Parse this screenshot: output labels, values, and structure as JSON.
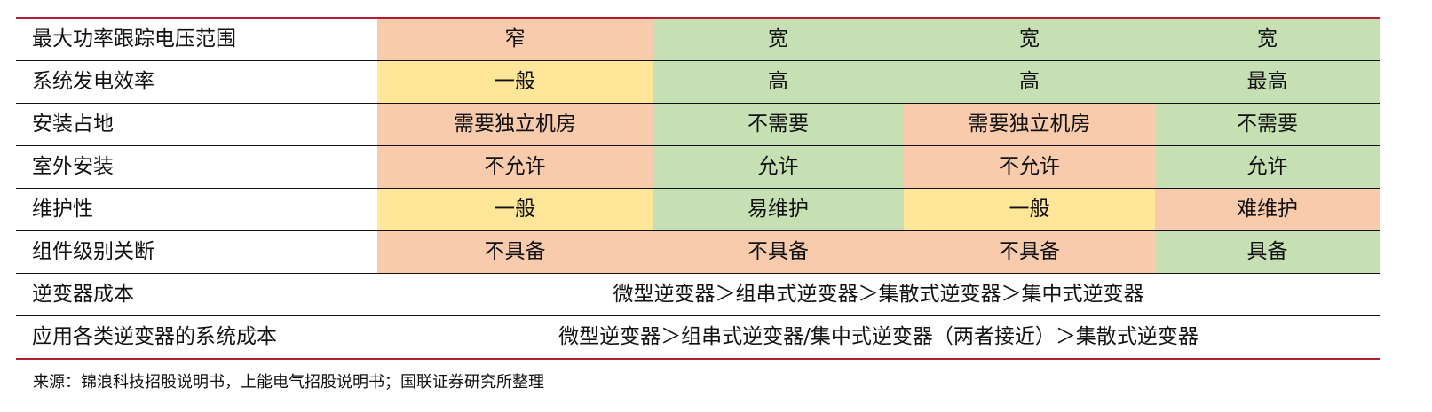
{
  "colors": {
    "border_accent": "#b01e2f",
    "narrow_bad": "#f8cbad",
    "medium": "#ffe699",
    "good": "#c6e0b4"
  },
  "rows": [
    {
      "label": "最大功率跟踪电压范围",
      "cells": [
        {
          "text": "窄",
          "tone": "orange"
        },
        {
          "text": "宽",
          "tone": "green"
        },
        {
          "text": "宽",
          "tone": "green"
        },
        {
          "text": "宽",
          "tone": "green"
        }
      ]
    },
    {
      "label": "系统发电效率",
      "cells": [
        {
          "text": "一般",
          "tone": "yellow"
        },
        {
          "text": "高",
          "tone": "green"
        },
        {
          "text": "高",
          "tone": "green"
        },
        {
          "text": "最高",
          "tone": "green"
        }
      ]
    },
    {
      "label": "安装占地",
      "cells": [
        {
          "text": "需要独立机房",
          "tone": "orange"
        },
        {
          "text": "不需要",
          "tone": "green"
        },
        {
          "text": "需要独立机房",
          "tone": "orange"
        },
        {
          "text": "不需要",
          "tone": "green"
        }
      ]
    },
    {
      "label": "室外安装",
      "cells": [
        {
          "text": "不允许",
          "tone": "orange"
        },
        {
          "text": "允许",
          "tone": "green"
        },
        {
          "text": "不允许",
          "tone": "orange"
        },
        {
          "text": "允许",
          "tone": "green"
        }
      ]
    },
    {
      "label": "维护性",
      "cells": [
        {
          "text": "一般",
          "tone": "yellow"
        },
        {
          "text": "易维护",
          "tone": "green"
        },
        {
          "text": "一般",
          "tone": "yellow"
        },
        {
          "text": "难维护",
          "tone": "orange"
        }
      ]
    },
    {
      "label": "组件级别关断",
      "cells": [
        {
          "text": "不具备",
          "tone": "orange"
        },
        {
          "text": "不具备",
          "tone": "orange"
        },
        {
          "text": "不具备",
          "tone": "orange"
        },
        {
          "text": "具备",
          "tone": "green"
        }
      ]
    }
  ],
  "span_rows": [
    {
      "label": "逆变器成本",
      "text": "微型逆变器＞组串式逆变器＞集散式逆变器＞集中式逆变器"
    },
    {
      "label": "应用各类逆变器的系统成本",
      "text": "微型逆变器＞组串式逆变器/集中式逆变器（两者接近）＞集散式逆变器"
    }
  ],
  "source": "来源：锦浪科技招股说明书，上能电气招股说明书；国联证券研究所整理"
}
